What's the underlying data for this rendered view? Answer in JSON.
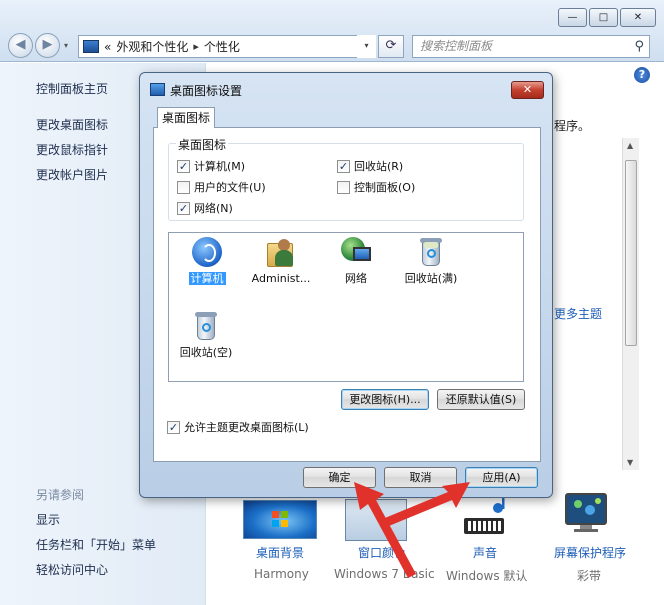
{
  "window": {
    "minimize": "—",
    "maximize": "□",
    "close": "✕",
    "back": "◀",
    "forward": "▶",
    "address": {
      "prefix": "«",
      "crumb1": "外观和个性化",
      "sep": "▸",
      "crumb2": "个性化",
      "dropdown": "▾"
    },
    "refresh": "⟳",
    "search_placeholder": "搜索控制面板",
    "search_icon": "⚲",
    "help": "?"
  },
  "left_pane": {
    "home": "控制面板主页",
    "links": [
      "更改桌面图标",
      "更改鼠标指针",
      "更改帐户图片"
    ],
    "see_also_title": "另请参阅",
    "see_also": [
      "显示",
      "任务栏和「开始」菜单",
      "轻松访问中心"
    ]
  },
  "right_pane": {
    "partial_text": "程序。",
    "more_themes": "更多主题",
    "themes": [
      {
        "label": "桌面背景",
        "sub": "Harmony"
      },
      {
        "label": "窗口颜色",
        "sub": "Windows 7 Basic"
      },
      {
        "label": "声音",
        "sub": "Windows 默认"
      },
      {
        "label": "屏幕保护程序",
        "sub": "彩带"
      }
    ]
  },
  "dialog": {
    "title": "桌面图标设置",
    "close": "✕",
    "tab": "桌面图标",
    "group_label": "桌面图标",
    "checkboxes": [
      {
        "label": "计算机(M)",
        "checked": true
      },
      {
        "label": "回收站(R)",
        "checked": true
      },
      {
        "label": "用户的文件(U)",
        "checked": false
      },
      {
        "label": "控制面板(O)",
        "checked": false
      },
      {
        "label": "网络(N)",
        "checked": true
      }
    ],
    "icons": [
      {
        "label": "计算机",
        "icon": "computer-icon"
      },
      {
        "label": "Administ...",
        "icon": "user-folder-icon"
      },
      {
        "label": "网络",
        "icon": "network-icon"
      },
      {
        "label": "回收站(满)",
        "icon": "recycle-bin-full-icon"
      },
      {
        "label": "回收站(空)",
        "icon": "recycle-bin-empty-icon"
      }
    ],
    "change_icon": "更改图标(H)...",
    "restore_default": "还原默认值(S)",
    "allow_themes": "允许主题更改桌面图标(L)",
    "allow_themes_checked": true,
    "ok": "确定",
    "cancel": "取消",
    "apply": "应用(A)",
    "check_mark": "✓"
  },
  "colors": {
    "annotation_arrow": "#e0322b",
    "selection": "#3399ff",
    "link": "#1e5fb8"
  }
}
